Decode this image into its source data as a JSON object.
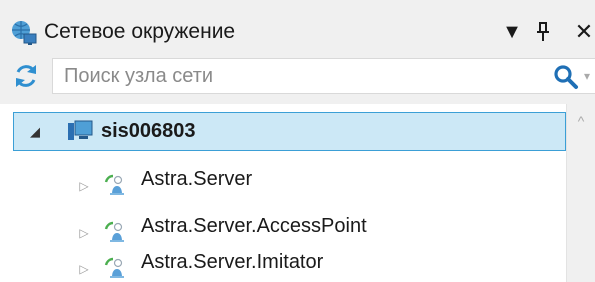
{
  "panel": {
    "title": "Сетевое окружение",
    "buttons": {
      "menu_glyph": "▼",
      "pin_glyph": "ᵖ",
      "close_glyph": "✕"
    }
  },
  "search": {
    "placeholder": "Поиск узла сети",
    "value": ""
  },
  "tree": {
    "root": {
      "label": "sis006803",
      "expanded": true,
      "icon": "computer-icon",
      "children": [
        {
          "label": "Astra.Server",
          "icon": "server-node-icon",
          "expanded": false
        },
        {
          "label": "Astra.Server.AccessPoint",
          "icon": "server-node-icon",
          "expanded": false
        },
        {
          "label": "Astra.Server.Imitator",
          "icon": "server-node-icon",
          "expanded": false
        }
      ]
    }
  },
  "colors": {
    "selection_bg": "#cce8f6",
    "selection_border": "#3b9fd6",
    "refresh_icon": "#2f8fd0",
    "search_icon": "#1f6fb5",
    "node_icon_green": "#4caf50",
    "node_icon_blue": "#5aa0d8"
  }
}
